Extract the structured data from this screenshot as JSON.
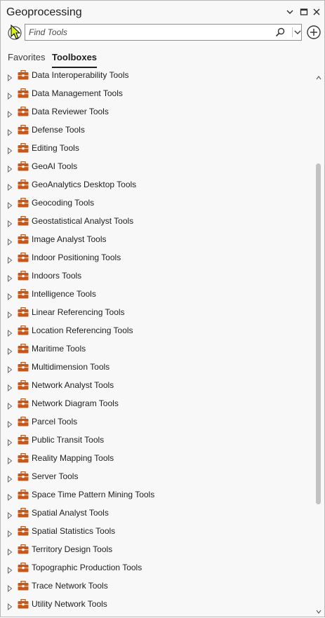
{
  "window": {
    "title": "Geoprocessing",
    "controls": [
      "chevron-down-icon",
      "restore-icon",
      "close-icon"
    ]
  },
  "search": {
    "placeholder": "Find Tools",
    "value": ""
  },
  "tabs": [
    {
      "label": "Favorites",
      "active": false
    },
    {
      "label": "Toolboxes",
      "active": true
    }
  ],
  "colors": {
    "toolbox_icon": "#c4581c",
    "background": "#f8f8f8",
    "scroll_thumb": "#c2c2c2",
    "cursor_fill": "#d6f215"
  },
  "toolboxes": [
    "Data Interoperability Tools",
    "Data Management Tools",
    "Data Reviewer Tools",
    "Defense Tools",
    "Editing Tools",
    "GeoAI Tools",
    "GeoAnalytics Desktop Tools",
    "Geocoding Tools",
    "Geostatistical Analyst Tools",
    "Image Analyst Tools",
    "Indoor Positioning Tools",
    "Indoors Tools",
    "Intelligence Tools",
    "Linear Referencing Tools",
    "Location Referencing Tools",
    "Maritime Tools",
    "Multidimension Tools",
    "Network Analyst Tools",
    "Network Diagram Tools",
    "Parcel Tools",
    "Public Transit Tools",
    "Reality Mapping Tools",
    "Server Tools",
    "Space Time Pattern Mining Tools",
    "Spatial Analyst Tools",
    "Spatial Statistics Tools",
    "Territory Design Tools",
    "Topographic Production Tools",
    "Trace Network Tools",
    "Utility Network Tools"
  ]
}
